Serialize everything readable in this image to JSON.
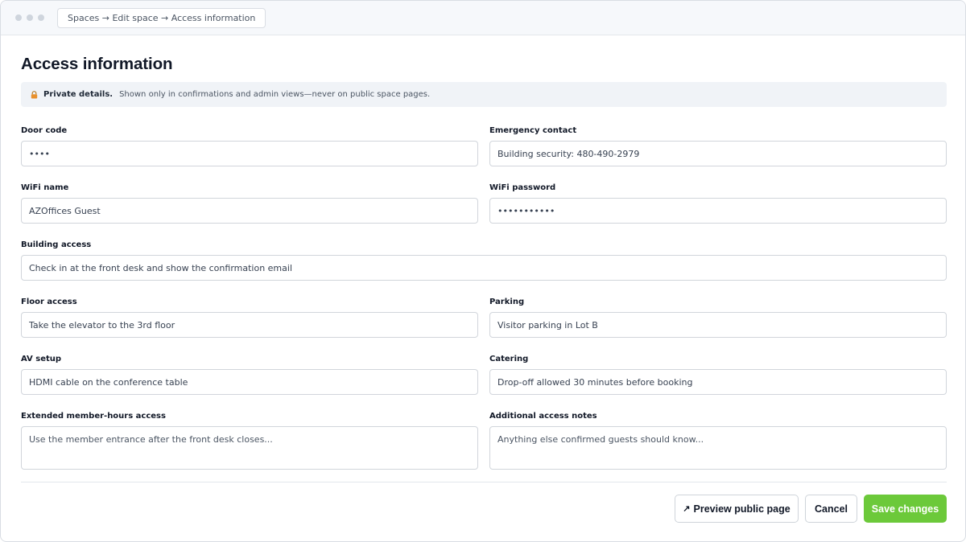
{
  "window": {
    "breadcrumb": "Spaces → Edit space → Access information"
  },
  "page": {
    "title": "Access information",
    "notice": {
      "strong": "Private details.",
      "text": "Shown only in confirmations and admin views—never on public space pages."
    }
  },
  "fields": {
    "door_code": {
      "label": "Door code",
      "value": "••••"
    },
    "emergency_contact": {
      "label": "Emergency contact",
      "value": "Building security: 480-490-2979"
    },
    "wifi_name": {
      "label": "WiFi name",
      "value": "AZOffices Guest"
    },
    "wifi_password": {
      "label": "WiFi password",
      "value": "•••••••••••"
    },
    "building_access": {
      "label": "Building access",
      "value": "Check in at the front desk and show the confirmation email"
    },
    "floor_access": {
      "label": "Floor access",
      "value": "Take the elevator to the 3rd floor"
    },
    "parking": {
      "label": "Parking",
      "value": "Visitor parking in Lot B"
    },
    "av_setup": {
      "label": "AV setup",
      "value": "HDMI cable on the conference table"
    },
    "catering": {
      "label": "Catering",
      "value": "Drop-off allowed 30 minutes before booking"
    },
    "extended_hours": {
      "label": "Extended member-hours access",
      "placeholder": "Use the member entrance after the front desk closes..."
    },
    "additional_notes": {
      "label": "Additional access notes",
      "placeholder": "Anything else confirmed guests should know..."
    }
  },
  "actions": {
    "preview_arrow": "↗",
    "preview": "Preview public page",
    "cancel": "Cancel",
    "save": "Save changes"
  },
  "colors": {
    "primary": "#6cc93a",
    "lock_icon": "#e8912d"
  },
  "icons": {
    "lock": "lock-icon",
    "external_link": "external-link-icon"
  }
}
